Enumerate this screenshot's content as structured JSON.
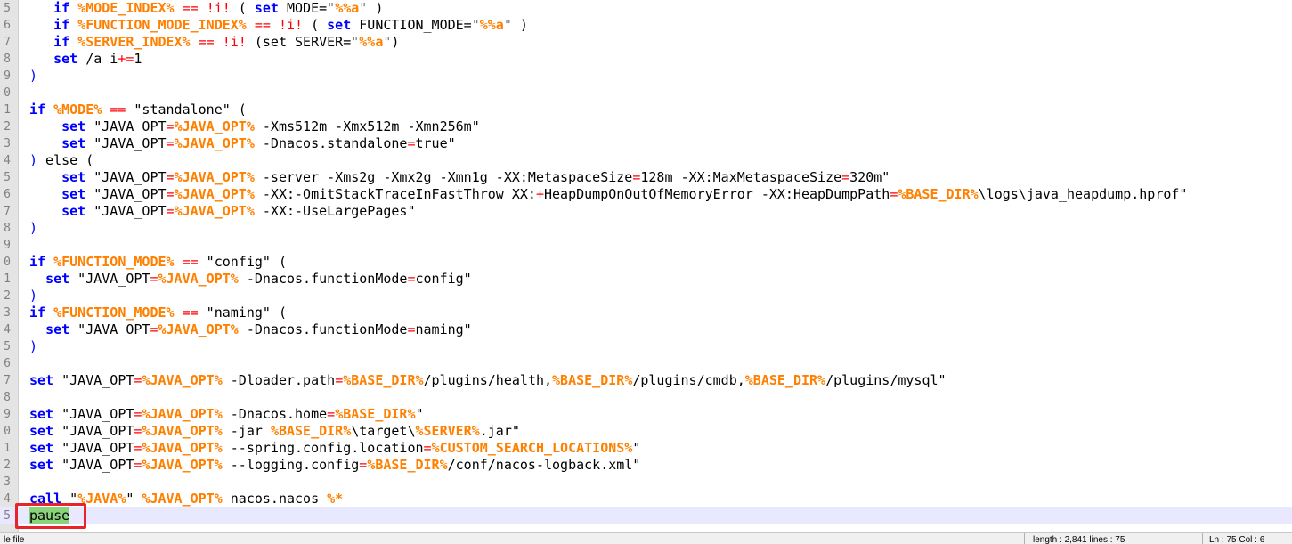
{
  "editor": {
    "lines": [
      {
        "num": "5",
        "indent": "   ",
        "tokens": [
          [
            "kw",
            "if"
          ],
          [
            "t",
            " "
          ],
          [
            "var",
            "%MODE_INDEX%"
          ],
          [
            "t",
            " "
          ],
          [
            "op",
            "=="
          ],
          [
            "t",
            " "
          ],
          [
            "op",
            "!i!"
          ],
          [
            "t",
            " ( "
          ],
          [
            "kw",
            "set"
          ],
          [
            "t",
            " MODE="
          ],
          [
            "str",
            "\""
          ],
          [
            "var",
            "%%a"
          ],
          [
            "str",
            "\""
          ],
          [
            "t",
            " )"
          ]
        ]
      },
      {
        "num": "6",
        "indent": "   ",
        "tokens": [
          [
            "kw",
            "if"
          ],
          [
            "t",
            " "
          ],
          [
            "var",
            "%FUNCTION_MODE_INDEX%"
          ],
          [
            "t",
            " "
          ],
          [
            "op",
            "=="
          ],
          [
            "t",
            " "
          ],
          [
            "op",
            "!i!"
          ],
          [
            "t",
            " ( "
          ],
          [
            "kw",
            "set"
          ],
          [
            "t",
            " FUNCTION_MODE="
          ],
          [
            "str",
            "\""
          ],
          [
            "var",
            "%%a"
          ],
          [
            "str",
            "\""
          ],
          [
            "t",
            " )"
          ]
        ]
      },
      {
        "num": "7",
        "indent": "   ",
        "tokens": [
          [
            "kw",
            "if"
          ],
          [
            "t",
            " "
          ],
          [
            "var",
            "%SERVER_INDEX%"
          ],
          [
            "t",
            " "
          ],
          [
            "op",
            "=="
          ],
          [
            "t",
            " "
          ],
          [
            "op",
            "!i!"
          ],
          [
            "t",
            " (set SERVER="
          ],
          [
            "str",
            "\""
          ],
          [
            "var",
            "%%a"
          ],
          [
            "str",
            "\""
          ],
          [
            "t",
            ")"
          ]
        ]
      },
      {
        "num": "8",
        "indent": "   ",
        "tokens": [
          [
            "kw",
            "set"
          ],
          [
            "t",
            " /a i"
          ],
          [
            "op",
            "+="
          ],
          [
            "t",
            "1"
          ]
        ]
      },
      {
        "num": "9",
        "indent": "",
        "tokens": [
          [
            "brace",
            ")"
          ]
        ]
      },
      {
        "num": "0",
        "indent": "",
        "tokens": []
      },
      {
        "num": "1",
        "indent": "",
        "tokens": [
          [
            "kw",
            "if"
          ],
          [
            "t",
            " "
          ],
          [
            "var",
            "%MODE%"
          ],
          [
            "t",
            " "
          ],
          [
            "op",
            "=="
          ],
          [
            "t",
            " \"standalone\" ("
          ]
        ]
      },
      {
        "num": "2",
        "indent": "    ",
        "tokens": [
          [
            "kw",
            "set"
          ],
          [
            "t",
            " \"JAVA_OPT"
          ],
          [
            "op",
            "="
          ],
          [
            "var",
            "%JAVA_OPT%"
          ],
          [
            "t",
            " -Xms512m -Xmx512m -Xmn256m\""
          ]
        ]
      },
      {
        "num": "3",
        "indent": "    ",
        "tokens": [
          [
            "kw",
            "set"
          ],
          [
            "t",
            " \"JAVA_OPT"
          ],
          [
            "op",
            "="
          ],
          [
            "var",
            "%JAVA_OPT%"
          ],
          [
            "t",
            " -Dnacos.standalone"
          ],
          [
            "op",
            "="
          ],
          [
            "t",
            "true\""
          ]
        ]
      },
      {
        "num": "4",
        "indent": "",
        "tokens": [
          [
            "brace",
            ")"
          ],
          [
            "t",
            " else ("
          ]
        ]
      },
      {
        "num": "5",
        "indent": "    ",
        "tokens": [
          [
            "kw",
            "set"
          ],
          [
            "t",
            " \"JAVA_OPT"
          ],
          [
            "op",
            "="
          ],
          [
            "var",
            "%JAVA_OPT%"
          ],
          [
            "t",
            " -server -Xms2g -Xmx2g -Xmn1g -XX:MetaspaceSize"
          ],
          [
            "op",
            "="
          ],
          [
            "t",
            "128m -XX:MaxMetaspaceSize"
          ],
          [
            "op",
            "="
          ],
          [
            "t",
            "320m\""
          ]
        ]
      },
      {
        "num": "6",
        "indent": "    ",
        "tokens": [
          [
            "kw",
            "set"
          ],
          [
            "t",
            " \"JAVA_OPT"
          ],
          [
            "op",
            "="
          ],
          [
            "var",
            "%JAVA_OPT%"
          ],
          [
            "t",
            " -XX:-OmitStackTraceInFastThrow XX:"
          ],
          [
            "op",
            "+"
          ],
          [
            "t",
            "HeapDumpOnOutOfMemoryError -XX:HeapDumpPath"
          ],
          [
            "op",
            "="
          ],
          [
            "var",
            "%BASE_DIR%"
          ],
          [
            "t",
            "\\logs\\java_heapdump.hprof\""
          ]
        ]
      },
      {
        "num": "7",
        "indent": "    ",
        "tokens": [
          [
            "kw",
            "set"
          ],
          [
            "t",
            " \"JAVA_OPT"
          ],
          [
            "op",
            "="
          ],
          [
            "var",
            "%JAVA_OPT%"
          ],
          [
            "t",
            " -XX:-UseLargePages\""
          ]
        ]
      },
      {
        "num": "8",
        "indent": "",
        "tokens": [
          [
            "brace",
            ")"
          ]
        ]
      },
      {
        "num": "9",
        "indent": "",
        "tokens": []
      },
      {
        "num": "0",
        "indent": "",
        "tokens": [
          [
            "kw",
            "if"
          ],
          [
            "t",
            " "
          ],
          [
            "var",
            "%FUNCTION_MODE%"
          ],
          [
            "t",
            " "
          ],
          [
            "op",
            "=="
          ],
          [
            "t",
            " \"config\" ("
          ]
        ]
      },
      {
        "num": "1",
        "indent": "  ",
        "tokens": [
          [
            "kw",
            "set"
          ],
          [
            "t",
            " \"JAVA_OPT"
          ],
          [
            "op",
            "="
          ],
          [
            "var",
            "%JAVA_OPT%"
          ],
          [
            "t",
            " -Dnacos.functionMode"
          ],
          [
            "op",
            "="
          ],
          [
            "t",
            "config\""
          ]
        ]
      },
      {
        "num": "2",
        "indent": "",
        "tokens": [
          [
            "brace",
            ")"
          ]
        ]
      },
      {
        "num": "3",
        "indent": "",
        "tokens": [
          [
            "kw",
            "if"
          ],
          [
            "t",
            " "
          ],
          [
            "var",
            "%FUNCTION_MODE%"
          ],
          [
            "t",
            " "
          ],
          [
            "op",
            "=="
          ],
          [
            "t",
            " \"naming\" ("
          ]
        ]
      },
      {
        "num": "4",
        "indent": "  ",
        "tokens": [
          [
            "kw",
            "set"
          ],
          [
            "t",
            " \"JAVA_OPT"
          ],
          [
            "op",
            "="
          ],
          [
            "var",
            "%JAVA_OPT%"
          ],
          [
            "t",
            " -Dnacos.functionMode"
          ],
          [
            "op",
            "="
          ],
          [
            "t",
            "naming\""
          ]
        ]
      },
      {
        "num": "5",
        "indent": "",
        "tokens": [
          [
            "brace",
            ")"
          ]
        ]
      },
      {
        "num": "6",
        "indent": "",
        "tokens": []
      },
      {
        "num": "7",
        "indent": "",
        "tokens": [
          [
            "kw",
            "set"
          ],
          [
            "t",
            " \"JAVA_OPT"
          ],
          [
            "op",
            "="
          ],
          [
            "var",
            "%JAVA_OPT%"
          ],
          [
            "t",
            " -Dloader.path"
          ],
          [
            "op",
            "="
          ],
          [
            "var",
            "%BASE_DIR%"
          ],
          [
            "t",
            "/plugins/health,"
          ],
          [
            "var",
            "%BASE_DIR%"
          ],
          [
            "t",
            "/plugins/cmdb,"
          ],
          [
            "var",
            "%BASE_DIR%"
          ],
          [
            "t",
            "/plugins/mysql\""
          ]
        ]
      },
      {
        "num": "8",
        "indent": "",
        "tokens": []
      },
      {
        "num": "9",
        "indent": "",
        "tokens": [
          [
            "kw",
            "set"
          ],
          [
            "t",
            " \"JAVA_OPT"
          ],
          [
            "op",
            "="
          ],
          [
            "var",
            "%JAVA_OPT%"
          ],
          [
            "t",
            " -Dnacos.home"
          ],
          [
            "op",
            "="
          ],
          [
            "var",
            "%BASE_DIR%"
          ],
          [
            "t",
            "\""
          ]
        ]
      },
      {
        "num": "0",
        "indent": "",
        "tokens": [
          [
            "kw",
            "set"
          ],
          [
            "t",
            " \"JAVA_OPT"
          ],
          [
            "op",
            "="
          ],
          [
            "var",
            "%JAVA_OPT%"
          ],
          [
            "t",
            " -jar "
          ],
          [
            "var",
            "%BASE_DIR%"
          ],
          [
            "t",
            "\\target\\"
          ],
          [
            "var",
            "%SERVER%"
          ],
          [
            "t",
            ".jar\""
          ]
        ]
      },
      {
        "num": "1",
        "indent": "",
        "tokens": [
          [
            "kw",
            "set"
          ],
          [
            "t",
            " \"JAVA_OPT"
          ],
          [
            "op",
            "="
          ],
          [
            "var",
            "%JAVA_OPT%"
          ],
          [
            "t",
            " --spring.config.location"
          ],
          [
            "op",
            "="
          ],
          [
            "var",
            "%CUSTOM_SEARCH_LOCATIONS%"
          ],
          [
            "t",
            "\""
          ]
        ]
      },
      {
        "num": "2",
        "indent": "",
        "tokens": [
          [
            "kw",
            "set"
          ],
          [
            "t",
            " \"JAVA_OPT"
          ],
          [
            "op",
            "="
          ],
          [
            "var",
            "%JAVA_OPT%"
          ],
          [
            "t",
            " --logging.config"
          ],
          [
            "op",
            "="
          ],
          [
            "var",
            "%BASE_DIR%"
          ],
          [
            "t",
            "/conf/nacos-logback.xml\""
          ]
        ]
      },
      {
        "num": "3",
        "indent": "",
        "tokens": []
      },
      {
        "num": "4",
        "indent": "",
        "tokens": [
          [
            "kw",
            "call"
          ],
          [
            "t",
            " \""
          ],
          [
            "var",
            "%JAVA%"
          ],
          [
            "t",
            "\" "
          ],
          [
            "var",
            "%JAVA_OPT%"
          ],
          [
            "t",
            " nacos.nacos "
          ],
          [
            "var",
            "%*"
          ]
        ]
      },
      {
        "num": "5",
        "indent": "",
        "current": true,
        "tokens": [
          [
            "sel",
            "pause"
          ]
        ]
      }
    ]
  },
  "status": {
    "file_type": "le file",
    "length_info": "length : 2,841    lines : 75",
    "position_info": "Ln : 75    Col : 6"
  }
}
